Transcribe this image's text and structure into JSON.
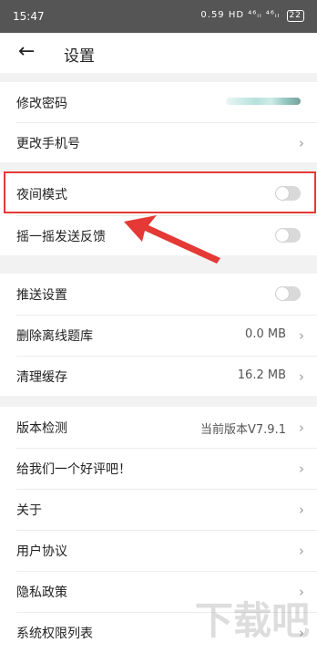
{
  "status_bar": {
    "time": "15:47",
    "right_icons": "0.59 HD ⁴⁶ᵢₗ ⁴⁶ᵢₗ",
    "battery": "22"
  },
  "header": {
    "title": "设置"
  },
  "section1": [
    {
      "label": "修改密码",
      "value_redacted": true
    },
    {
      "label": "更改手机号"
    }
  ],
  "section2": [
    {
      "label": "夜间模式",
      "toggle": false
    },
    {
      "label": "摇一摇发送反馈",
      "toggle": false
    }
  ],
  "section3": [
    {
      "label": "推送设置",
      "toggle": false
    },
    {
      "label": "删除离线题库",
      "value": "0.0 MB"
    },
    {
      "label": "清理缓存",
      "value": "16.2 MB"
    }
  ],
  "section4": [
    {
      "label": "版本检测",
      "value": "当前版本V7.9.1"
    },
    {
      "label": "给我们一个好评吧！"
    },
    {
      "label": "关于"
    },
    {
      "label": "用户协议"
    },
    {
      "label": "隐私政策"
    },
    {
      "label": "系统权限列表"
    }
  ],
  "watermark": "下载吧",
  "colors": {
    "highlight": "#e53935",
    "arrow": "#e53935",
    "toggle_off": "#d9d9d9"
  }
}
